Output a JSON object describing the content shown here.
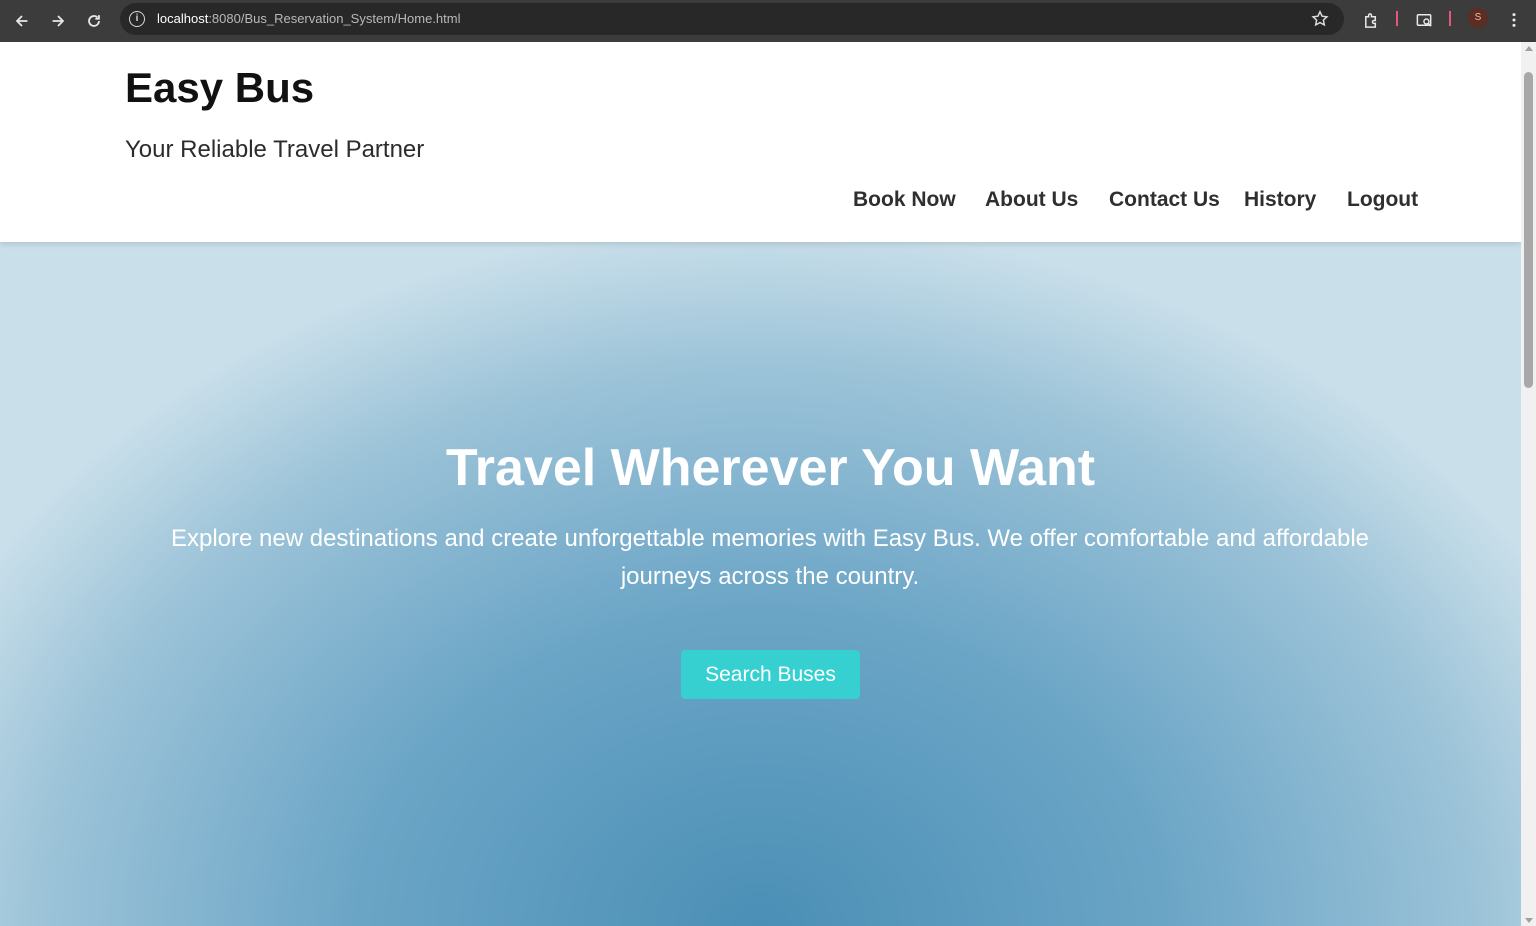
{
  "browser": {
    "url_host": "localhost",
    "url_path": ":8080/Bus_Reservation_System/Home.html",
    "profile_initial": "S",
    "site_info_glyph": "i"
  },
  "header": {
    "brand": "Easy Bus",
    "tagline": "Your Reliable Travel Partner",
    "nav": {
      "book_now": "Book Now",
      "about_us": "About Us",
      "contact_us": "Contact Us",
      "history": "History",
      "logout": "Logout"
    }
  },
  "hero": {
    "title": "Travel Wherever You Want",
    "text": "Explore new destinations and create unforgettable memories with Easy Bus. We offer comfortable and affordable journeys across the country.",
    "button_label": "Search Buses"
  },
  "colors": {
    "button": "#35d0cf",
    "hero_center": "#4b8fb6",
    "hero_edge": "#c9dfea",
    "chrome_bg": "#3c3c3c"
  }
}
